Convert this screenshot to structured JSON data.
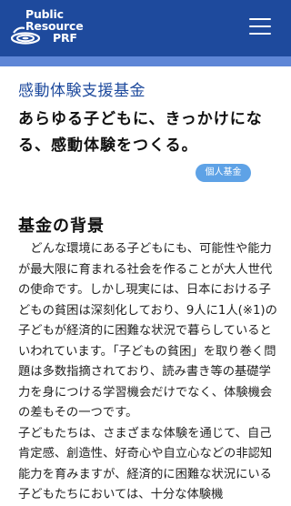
{
  "header": {
    "logo_line1": "Public",
    "logo_line2": "Resource",
    "logo_line3": "PRF",
    "menu_icon": "hamburger-menu-icon"
  },
  "colors": {
    "header_bg": "#1e4a9d",
    "accent_bar": "#5e86d6",
    "title_color": "#1e4a9d",
    "tag_bg": "#5ea2e6"
  },
  "fund": {
    "title": "感動体験支援基金",
    "catch": "あらゆる子どもに、きっかけになる、感動体験をつくる。",
    "tag": "個人基金"
  },
  "section": {
    "title": "基金の背景",
    "body": "　どんな環境にある子どもにも、可能性や能力が最大限に育まれる社会を作ることが大人世代の使命です。しかし現実には、日本における子どもの貧困は深刻化しており、9人に1人(※1)の子どもが経済的に困難な状況で暮らしているといわれています。「子どもの貧困」を取り巻く問題は多数指摘されており、読み書き等の基礎学力を身につける学習機会だけでなく、体験機会の差もその一つです。\n子どもたちは、さまざまな体験を通じて、自己肯定感、創造性、好奇心や自立心などの非認知能力を育みますが、経済的に困難な状況にいる子どもたちにおいては、十分な体験機"
  }
}
